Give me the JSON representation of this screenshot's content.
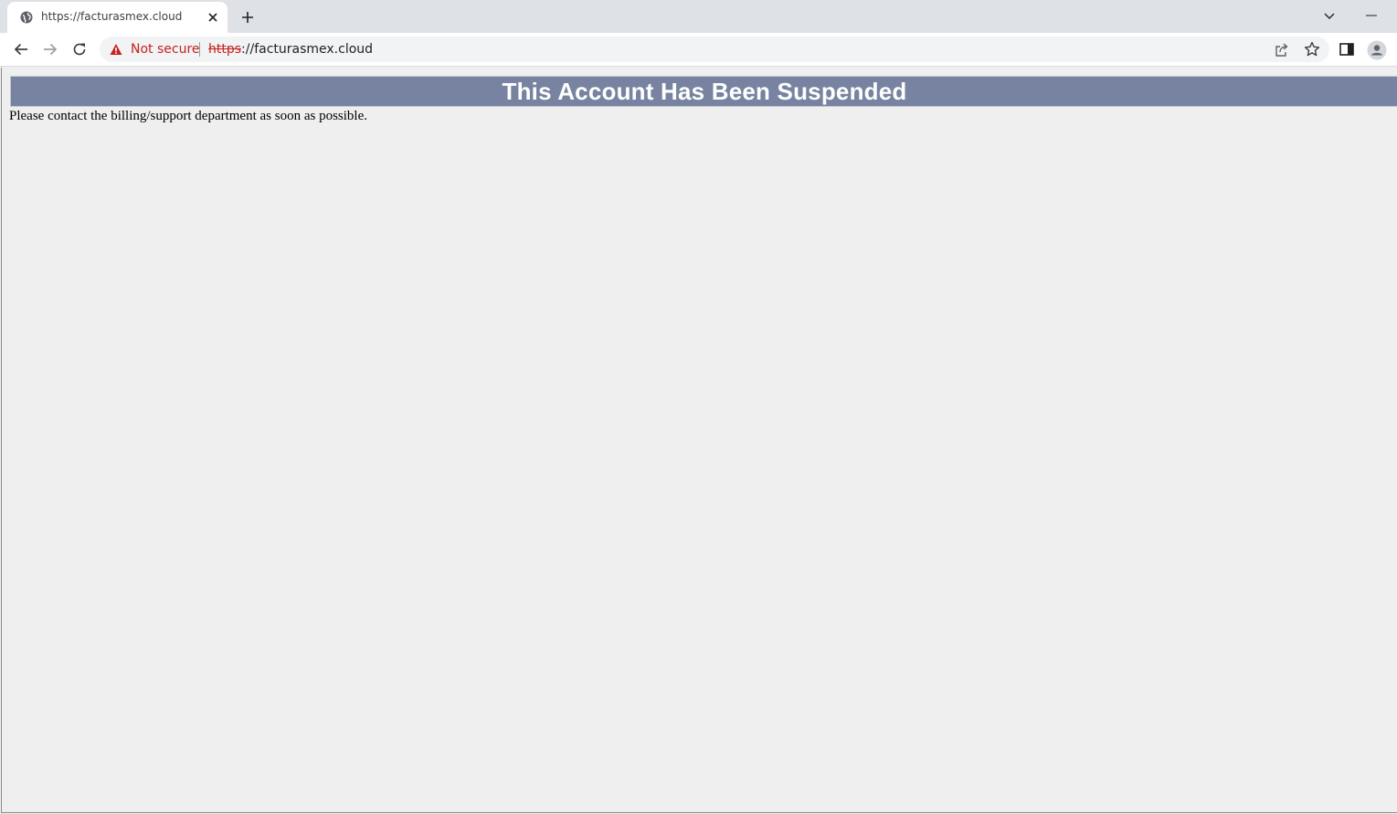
{
  "browser": {
    "tab": {
      "title": "https://facturasmex.cloud",
      "favicon": "globe-icon"
    },
    "new_tab_icon": "plus-icon",
    "tab_search_icon": "chevron-down-icon",
    "window_control_icon": "minimize-icon",
    "toolbar": {
      "back_icon": "arrow-left-icon",
      "forward_icon": "arrow-right-icon",
      "reload_icon": "reload-icon",
      "security_icon": "warning-icon",
      "security_label": "Not secure",
      "url_scheme": "https",
      "url_rest": "://facturasmex.cloud",
      "share_icon": "share-icon",
      "bookmark_icon": "star-icon",
      "side_panel_icon": "side-panel-icon",
      "profile_icon": "profile-icon"
    },
    "colors": {
      "tabstrip": "#dee1e6",
      "warning": "#c5221f"
    }
  },
  "page": {
    "heading": "This Account Has Been Suspended",
    "message": "Please contact the billing/support department as soon as possible.",
    "colors": {
      "banner_background": "#7783a0",
      "banner_text": "#ffffff",
      "page_background": "#efefef"
    }
  }
}
